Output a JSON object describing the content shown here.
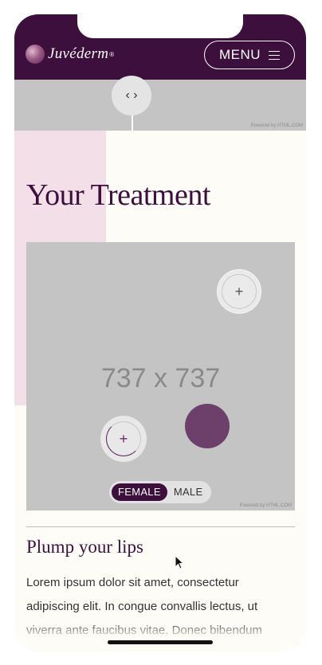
{
  "header": {
    "brand": "Juvéderm",
    "brand_mark": "®",
    "menu_label": "MENU"
  },
  "banner": {
    "toggle_glyph": "‹ ›",
    "powered_by": "Powered by HTML.COM"
  },
  "main": {
    "title": "Your Treatment",
    "image_placeholder": "737 x 737",
    "image_powered_by": "Powered by HTML.COM",
    "hotspot_glyph": "+",
    "gender_options": [
      "FEMALE",
      "MALE"
    ],
    "selected_gender": "FEMALE",
    "subtitle": "Plump your lips",
    "body": "Lorem ipsum dolor sit amet, consectetur adipiscing elit. In congue convallis lectus, ut viverra ante faucibus vitae. Donec bibendum eleifend commodo."
  },
  "colors": {
    "brand_purple": "#3d0f3d",
    "accent_pink": "#f2dfe8",
    "placeholder_gray": "#c4c4c4",
    "hotspot_purple": "#6d3f6b"
  },
  "icons": {
    "menu": "hamburger-icon",
    "toggle": "code-brackets-icon",
    "hotspot": "plus-icon"
  }
}
